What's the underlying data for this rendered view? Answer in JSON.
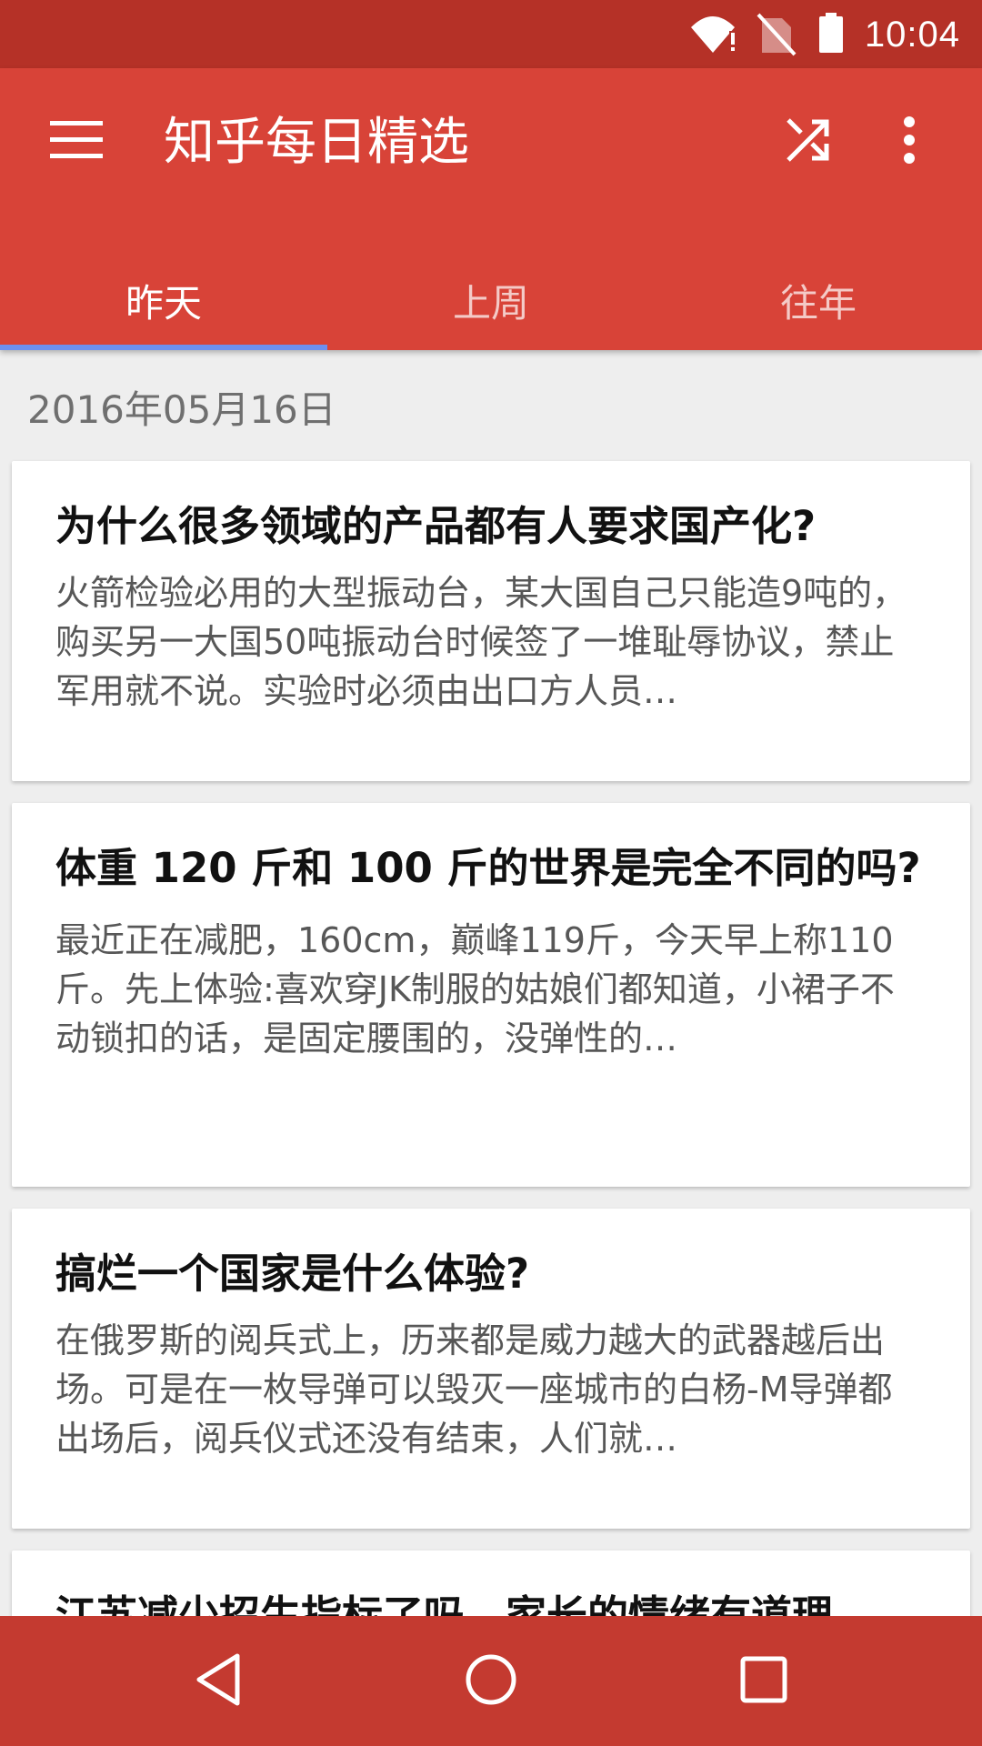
{
  "status_bar": {
    "time": "10:04",
    "icons": [
      "wifi-alert-icon",
      "no-sim-icon",
      "battery-icon"
    ]
  },
  "app_bar": {
    "title": "知乎每日精选",
    "icons": {
      "menu": "menu-icon",
      "shuffle": "shuffle-icon",
      "more": "more-vert-icon"
    },
    "tabs": [
      {
        "label": "昨天",
        "active": true
      },
      {
        "label": "上周",
        "active": false
      },
      {
        "label": "往年",
        "active": false
      }
    ]
  },
  "feed": {
    "date": "2016年05月16日",
    "cards": [
      {
        "title": "为什么很多领域的产品都有人要求国产化?",
        "excerpt": "火箭检验必用的大型振动台，某大国自己只能造9吨的，购买另一大国50吨振动台时候签了一堆耻辱协议，禁止军用就不说。实验时必须由出口方人员…"
      },
      {
        "title": "体重 120 斤和 100 斤的世界是完全不同的吗?",
        "excerpt": "最近正在减肥，160cm，巅峰119斤，今天早上称110斤。先上体验:喜欢穿JK制服的姑娘们都知道，小裙子不动锁扣的话，是固定腰围的，没弹性的…"
      },
      {
        "title": "搞烂一个国家是什么体验?",
        "excerpt": "在俄罗斯的阅兵式上，历来都是威力越大的武器越后出场。可是在一枚导弹可以毁灭一座城市的白杨-M导弹都出场后，阅兵仪式还没有结束，人们就…"
      },
      {
        "title": "江苏减少招生指标了吗，家长的情绪有道理",
        "excerpt": ""
      }
    ]
  },
  "nav_bar": {
    "icons": [
      "back-icon",
      "home-icon",
      "recents-icon"
    ]
  },
  "colors": {
    "status_bar": "#b53127",
    "app_bar": "#d84338",
    "tab_indicator": "#6d8ff0",
    "nav_bar": "#c43a30",
    "background": "#eeeeee"
  }
}
